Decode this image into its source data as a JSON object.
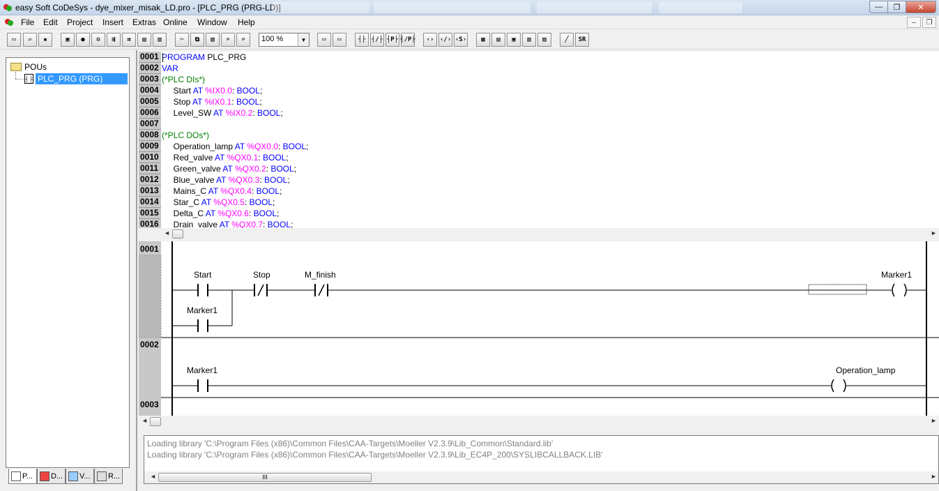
{
  "window": {
    "title": "easy Soft CoDeSys - dye_mixer_misak_LD.pro - [PLC_PRG (PRG-LD)]",
    "minimize": "—",
    "maximize": "❐",
    "close": "✕"
  },
  "menu": {
    "items": [
      "File",
      "Edit",
      "Project",
      "Insert",
      "Extras",
      "Online",
      "Window",
      "Help"
    ],
    "mdi_minimize": "–",
    "mdi_restore": "❐"
  },
  "toolbar": {
    "zoom_value": "100 %",
    "zoom_arrow": "▼",
    "ld_buttons": [
      "┤├",
      "┤/├",
      "┤P├",
      "┤/P├",
      "‹›",
      "‹/›",
      "‹S›",
      "▦",
      "▤",
      "▣",
      "▥",
      "▨",
      "╱",
      "SR"
    ]
  },
  "tree": {
    "root": "POUs",
    "child": "PLC_PRG (PRG)",
    "child_icon": "┤├"
  },
  "left_tabs": [
    "P...",
    "D...",
    "V...",
    "R..."
  ],
  "declaration": {
    "line_numbers": [
      "0001",
      "0002",
      "0003",
      "0004",
      "0005",
      "0006",
      "0007",
      "0008",
      "0009",
      "0010",
      "0011",
      "0012",
      "0013",
      "0014",
      "0015",
      "0016"
    ],
    "lines": [
      {
        "parts": [
          {
            "t": "PROGRAM",
            "c": "kw"
          },
          {
            "t": " PLC_PRG",
            "c": ""
          }
        ]
      },
      {
        "parts": [
          {
            "t": "VAR",
            "c": "kw"
          }
        ]
      },
      {
        "parts": [
          {
            "t": "(*PLC DIs*)",
            "c": "cmt"
          }
        ]
      },
      {
        "parts": [
          {
            "t": "     Start ",
            "c": ""
          },
          {
            "t": "AT",
            "c": "kw"
          },
          {
            "t": " %IX0.0",
            "c": "addr"
          },
          {
            "t": ": ",
            "c": ""
          },
          {
            "t": "BOOL",
            "c": "kw"
          },
          {
            "t": ";",
            "c": ""
          }
        ]
      },
      {
        "parts": [
          {
            "t": "     Stop ",
            "c": ""
          },
          {
            "t": "AT",
            "c": "kw"
          },
          {
            "t": " %IX0.1",
            "c": "addr"
          },
          {
            "t": ": ",
            "c": ""
          },
          {
            "t": "BOOL",
            "c": "kw"
          },
          {
            "t": ";",
            "c": ""
          }
        ]
      },
      {
        "parts": [
          {
            "t": "     Level_SW ",
            "c": ""
          },
          {
            "t": "AT",
            "c": "kw"
          },
          {
            "t": " %IX0.2",
            "c": "addr"
          },
          {
            "t": ": ",
            "c": ""
          },
          {
            "t": "BOOL",
            "c": "kw"
          },
          {
            "t": ";",
            "c": ""
          }
        ]
      },
      {
        "parts": []
      },
      {
        "parts": [
          {
            "t": "(*PLC DOs*)",
            "c": "cmt"
          }
        ]
      },
      {
        "parts": [
          {
            "t": "     Operation_lamp ",
            "c": ""
          },
          {
            "t": "AT",
            "c": "kw"
          },
          {
            "t": " %QX0.0",
            "c": "addr"
          },
          {
            "t": ": ",
            "c": ""
          },
          {
            "t": "BOOL",
            "c": "kw"
          },
          {
            "t": ";",
            "c": ""
          }
        ]
      },
      {
        "parts": [
          {
            "t": "     Red_valve ",
            "c": ""
          },
          {
            "t": "AT",
            "c": "kw"
          },
          {
            "t": " %QX0.1",
            "c": "addr"
          },
          {
            "t": ": ",
            "c": ""
          },
          {
            "t": "BOOL",
            "c": "kw"
          },
          {
            "t": ";",
            "c": ""
          }
        ]
      },
      {
        "parts": [
          {
            "t": "     Green_valve ",
            "c": ""
          },
          {
            "t": "AT",
            "c": "kw"
          },
          {
            "t": " %QX0.2",
            "c": "addr"
          },
          {
            "t": ": ",
            "c": ""
          },
          {
            "t": "BOOL",
            "c": "kw"
          },
          {
            "t": ";",
            "c": ""
          }
        ]
      },
      {
        "parts": [
          {
            "t": "     Blue_valve ",
            "c": ""
          },
          {
            "t": "AT",
            "c": "kw"
          },
          {
            "t": " %QX0.3",
            "c": "addr"
          },
          {
            "t": ": ",
            "c": ""
          },
          {
            "t": "BOOL",
            "c": "kw"
          },
          {
            "t": ";",
            "c": ""
          }
        ]
      },
      {
        "parts": [
          {
            "t": "     Mains_C ",
            "c": ""
          },
          {
            "t": "AT",
            "c": "kw"
          },
          {
            "t": " %QX0.4",
            "c": "addr"
          },
          {
            "t": ": ",
            "c": ""
          },
          {
            "t": "BOOL",
            "c": "kw"
          },
          {
            "t": ";",
            "c": ""
          }
        ]
      },
      {
        "parts": [
          {
            "t": "     Star_C ",
            "c": ""
          },
          {
            "t": "AT",
            "c": "kw"
          },
          {
            "t": " %QX0.5",
            "c": "addr"
          },
          {
            "t": ": ",
            "c": ""
          },
          {
            "t": "BOOL",
            "c": "kw"
          },
          {
            "t": ";",
            "c": ""
          }
        ]
      },
      {
        "parts": [
          {
            "t": "     Delta_C ",
            "c": ""
          },
          {
            "t": "AT",
            "c": "kw"
          },
          {
            "t": " %QX0.6",
            "c": "addr"
          },
          {
            "t": ": ",
            "c": ""
          },
          {
            "t": "BOOL",
            "c": "kw"
          },
          {
            "t": ";",
            "c": ""
          }
        ]
      },
      {
        "parts": [
          {
            "t": "     Drain_valve ",
            "c": ""
          },
          {
            "t": "AT",
            "c": "kw"
          },
          {
            "t": " %QX0.7",
            "c": "addr"
          },
          {
            "t": ": ",
            "c": ""
          },
          {
            "t": "BOOL",
            "c": "kw"
          },
          {
            "t": ";",
            "c": ""
          }
        ]
      }
    ]
  },
  "ladder": {
    "networks": [
      "0001",
      "0002",
      "0003"
    ],
    "n1": {
      "c1": "Start",
      "c2": "Stop",
      "c3": "M_finish",
      "parallel": "Marker1",
      "coil": "Marker1"
    },
    "n2": {
      "c1": "Marker1",
      "coil": "Operation_lamp"
    }
  },
  "messages": [
    "Loading library 'C:\\Program Files (x86)\\Common Files\\CAA-Targets\\Moeller V2.3.9\\Lib_Common\\Standard.lib'",
    "Loading library 'C:\\Program Files (x86)\\Common Files\\CAA-Targets\\Moeller V2.3.9\\Lib_EC4P_200\\SYSLIBCALLBACK.LIB'"
  ],
  "scroll": {
    "left": "◄",
    "right": "►",
    "grip": "III"
  },
  "colors": {
    "keyword": "#0000ff",
    "address": "#ff00ff",
    "comment": "#008000",
    "selection": "#3399ff"
  }
}
